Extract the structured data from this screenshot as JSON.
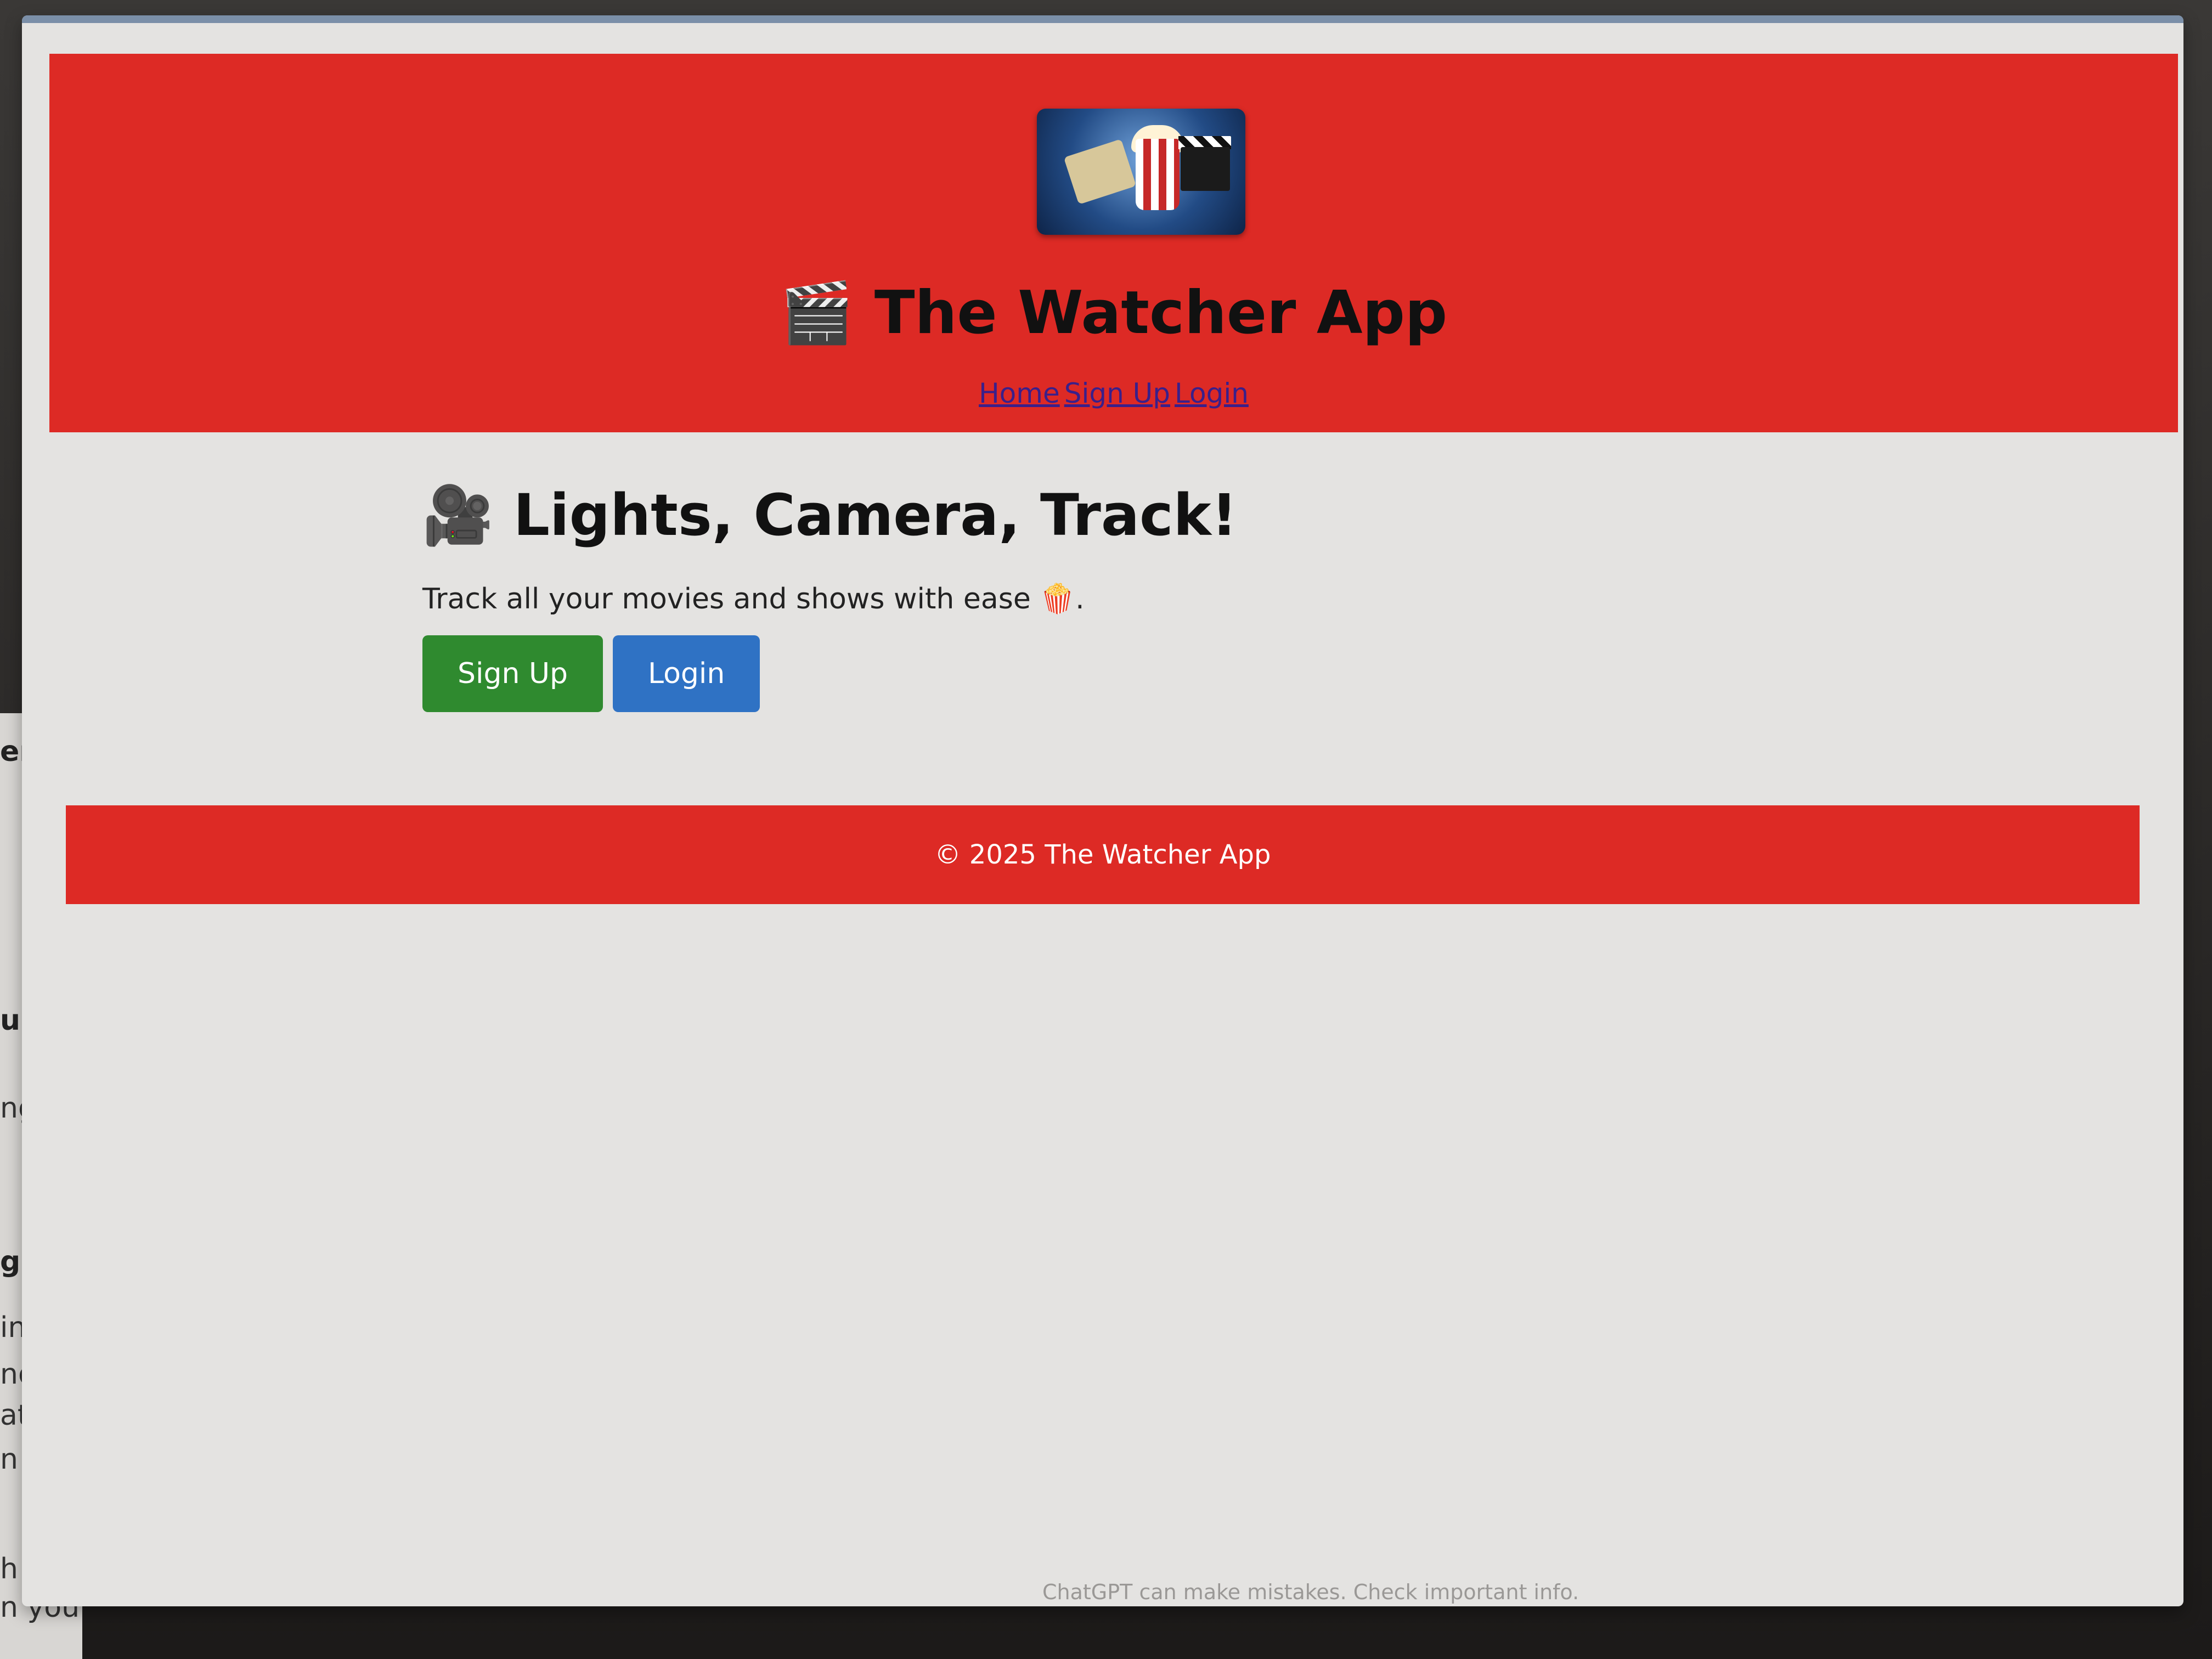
{
  "site": {
    "title": "🎬 The Watcher App",
    "logo_icon": "movie-night-logo-icon"
  },
  "nav": {
    "home": "Home",
    "signup": "Sign Up",
    "login": "Login"
  },
  "hero": {
    "title": "🎥 Lights, Camera, Track!",
    "subtitle": "Track all your movies and shows with ease 🍿."
  },
  "buttons": {
    "signup": "Sign Up",
    "login": "Login"
  },
  "footer": {
    "text": "© 2025 The Watcher App"
  },
  "background_app": {
    "fragments": [
      "er",
      "ure",
      "ng a",
      "g lis",
      "indi",
      "ndiv",
      "at th",
      "n you",
      "h go",
      "n you"
    ],
    "caption": "ChatGPT can make mistakes. Check important info."
  },
  "colors": {
    "header_bg": "#dd2a25",
    "footer_bg": "#dd2a25",
    "signup_button": "#2f8a2f",
    "login_button": "#2f72c4",
    "nav_link": "#3a1f8a",
    "page_bg": "#e4e3e1"
  }
}
